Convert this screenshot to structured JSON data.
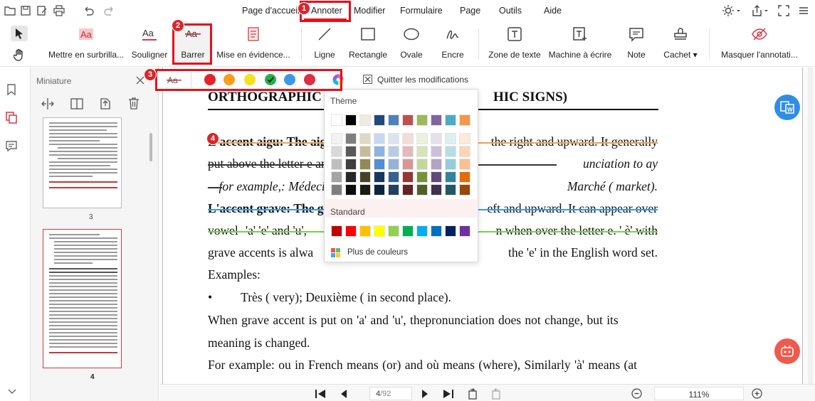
{
  "menu": {
    "items": [
      "Page d'accueil",
      "Annoter",
      "Modifier",
      "Formulaire",
      "Page",
      "Outils",
      "Aide"
    ],
    "active": "Annoter"
  },
  "ribbon": {
    "tools": [
      {
        "label": "Mettre en surbrilla...",
        "icon": "highlight-icon"
      },
      {
        "label": "Souligner",
        "icon": "underline-text-icon"
      },
      {
        "label": "Barrer",
        "icon": "strikethrough-text-icon"
      },
      {
        "label": "Mise en évidence...",
        "icon": "area-highlight-icon"
      },
      {
        "label": "Ligne",
        "icon": "line-icon"
      },
      {
        "label": "Rectangle",
        "icon": "rectangle-icon"
      },
      {
        "label": "Ovale",
        "icon": "oval-icon"
      },
      {
        "label": "Encre",
        "icon": "ink-icon"
      },
      {
        "label": "Zone de texte",
        "icon": "textbox-icon"
      },
      {
        "label": "Machine à écrire",
        "icon": "typewriter-icon"
      },
      {
        "label": "Note",
        "icon": "note-icon"
      },
      {
        "label": "Cachet ▾",
        "icon": "stamp-icon"
      },
      {
        "label": "Masquer l'annotati...",
        "icon": "hide-annotation-icon"
      }
    ],
    "active_tool": "Barrer"
  },
  "subtoolbar": {
    "quit_label": "Quitter les modifications",
    "colors": [
      "#e3242b",
      "#f7a11a",
      "#f7e01e",
      "#21b24b",
      "#3b9ae8",
      "#dd2e44"
    ],
    "selected_color": "#21b24b"
  },
  "sidebar": {
    "title": "Miniature",
    "pages": [
      {
        "number": "3"
      },
      {
        "number": "4",
        "selected": true
      }
    ]
  },
  "document": {
    "heading_left": "ORTHOGRAPHIC",
    "heading_right": "HIC SIGNS)",
    "lines": [
      {
        "left": "L'accent aigu: The aig",
        "right": "the right and upward. It generally"
      },
      {
        "left": "put above the letter e an",
        "right": "unciation to ay"
      },
      {
        "left": "—for example,: Médecin",
        "right": "Marché ( market)."
      },
      {
        "left": "L'accent grave: The g",
        "right": "eft and upward. It can appear over"
      },
      {
        "left": "vowel- 'a' 'e' and 'u',",
        "right": "n when over the letter e. ' è' with"
      },
      {
        "left": "grave  accents  is  alwa",
        "right": "the 'e' in  the  English  word set."
      },
      {
        "left": "Examples:",
        "right": ""
      }
    ],
    "bullet": "Très ( very);    Deuxième ( in second place).",
    "para1": "When grave accent is put on 'a' and 'u', thepronunciation does not change, but its",
    "para2": "meaning is changed.",
    "para3": "For example: ou in French means (or) and où means (where), Similarly 'à' means (at"
  },
  "color_picker": {
    "theme_label": "Thème",
    "standard_label": "Standard",
    "more_label": "Plus de couleurs",
    "theme_top": [
      "#ffffff",
      "#000000",
      "#eeece1",
      "#1f497d",
      "#4f81bd",
      "#c0504d",
      "#9bbb59",
      "#8064a2",
      "#4bacc6",
      "#f79646"
    ],
    "theme_shades": [
      [
        "#f2f2f2",
        "#7f7f7f",
        "#ddd9c3",
        "#c6d9f0",
        "#dbe5f1",
        "#f2dcdb",
        "#ebf1dd",
        "#e5e0ec",
        "#dbeef3",
        "#fdeada"
      ],
      [
        "#d8d8d8",
        "#595959",
        "#c4bd97",
        "#8db3e2",
        "#b8cce4",
        "#e5b9b7",
        "#d7e3bc",
        "#ccc1d9",
        "#b7dde8",
        "#fbd5b5"
      ],
      [
        "#bfbfbf",
        "#3f3f3f",
        "#938953",
        "#548dd4",
        "#95b3d7",
        "#d99694",
        "#c3d69b",
        "#b2a2c7",
        "#92cddc",
        "#fac08f"
      ],
      [
        "#a5a5a5",
        "#262626",
        "#494429",
        "#17365d",
        "#366092",
        "#953734",
        "#76923c",
        "#5f497a",
        "#31859b",
        "#e36c09"
      ],
      [
        "#7f7f7f",
        "#0c0c0c",
        "#1d1b10",
        "#0f243e",
        "#244061",
        "#632423",
        "#4f6128",
        "#3f3151",
        "#205867",
        "#974806"
      ]
    ],
    "standard": [
      "#c00000",
      "#ff0000",
      "#ffc000",
      "#ffff00",
      "#92d050",
      "#00b050",
      "#00b0f0",
      "#0070c0",
      "#002060",
      "#7030a0"
    ]
  },
  "bottombar": {
    "page_current": "4",
    "page_total": "/92",
    "zoom": "111%"
  },
  "callouts": [
    "1",
    "2",
    "3",
    "4"
  ]
}
